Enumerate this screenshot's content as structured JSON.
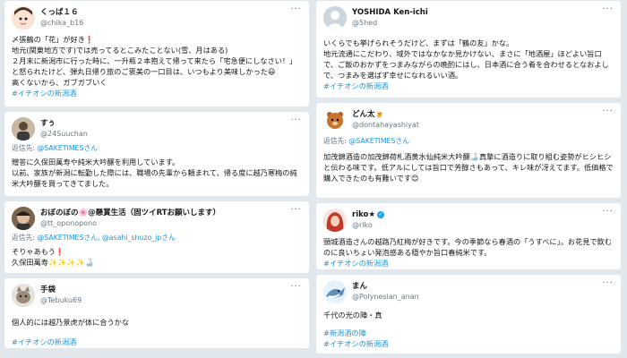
{
  "tweets_left": [
    {
      "name": "くっぱ１６",
      "handle": "@chika_b16",
      "text": "〆張鶴の「花」が好き❗\n地元(関東地方です)では売ってるとこみたことない(雪、月はある)\n２月末に新潟市に行った時に、一升瓶２本抱えて帰って来たら「宅急便にしなさい！」と怒られたけど、弾丸日帰り旅のご褒美の一口目は、いつもより美味しかった😃\n高くないから、ガブガブいく",
      "tag": "#イチオシの新潟酒"
    },
    {
      "name": "すぅ",
      "handle": "@24Suuchan",
      "reply_prefix": "返信先: ",
      "reply_mentions": "@SAKETIMESさん",
      "text": "贈答に久保田萬寿や純米大吟醸を利用しています。\n以前、家族が新潟に転勤した際には、職場の先輩から頼まれて、帰る度に越乃寒梅の純米大吟醸を買ってきてました。"
    },
    {
      "name": "おぼのぼの🌸@懸賞生活（固ツイRTお願いします）",
      "handle": "@tt_oponopono",
      "reply_prefix": "返信先: ",
      "reply_mentions": "@SAKETIMESさん, @asahi_shuzo_jpさん",
      "text": "そりゃあもう❗\n久保田萬寿✨✨✨✨🍶"
    },
    {
      "name": "手袋",
      "handle": "@Tebuku69",
      "text": "個人的には越乃景虎が体に合うかな",
      "tag": "#イチオシの新潟酒"
    }
  ],
  "tweets_right": [
    {
      "name": "YOSHIDA Ken-ichi",
      "handle": "@5hed",
      "text": "いくらでも挙げられそうだけど、まずは「鶴の友」かな。\n地元流通にこだわり、域外ではなかなか見かけない、まさに「地酒屋」ほどよい旨口で、ご飯のおかずをつまみながらの晩酌にはし、日本酒に合う肴を合わせるとなおよしで、つまみを選ばず幸せになれるいい酒。",
      "tag": "#イチオシの新潟酒"
    },
    {
      "name": "どん太🍺",
      "handle": "@dontahayashiyat",
      "reply_prefix": "返信先: ",
      "reply_mentions": "@SAKETIMESさん",
      "text": "加茂錦酒造の加茂錦荷札酒黄水仙純米大吟醸🍶真摯に酒造りに取り組む姿勢がヒシヒシと伝わる味です。低アルにしては旨口で芳醇さもあって、キレ味が冴えてます。低価格で購入できたのも有難いです😊"
    },
    {
      "name": "riko★",
      "handle": "@riko",
      "text": "頸城酒造さんの越路乃紅梅が好きです。今の季節なら春酒の「うすべに」。お花見で飲むのに良いちょい発泡感ある穏やか旨口春純米です。",
      "tag": "#イチオシの新潟酒"
    },
    {
      "name": "まん",
      "handle": "@Polynesian_anan",
      "text": "千代の光の陣・真",
      "tags": [
        "#新潟酒の陣",
        "#イチオシの新潟酒"
      ]
    }
  ],
  "more_label": "···",
  "colors": {
    "link": "#1b95e0",
    "muted": "#657786",
    "verified": "#1da1f2"
  },
  "avatars": [
    "cartoon-girl-avatar",
    "person-avatar",
    "face-avatar",
    "kitten-avatar",
    "default-silhouette-avatar",
    "bear-mascot-avatar",
    "red-hair-avatar",
    "shark-avatar"
  ]
}
